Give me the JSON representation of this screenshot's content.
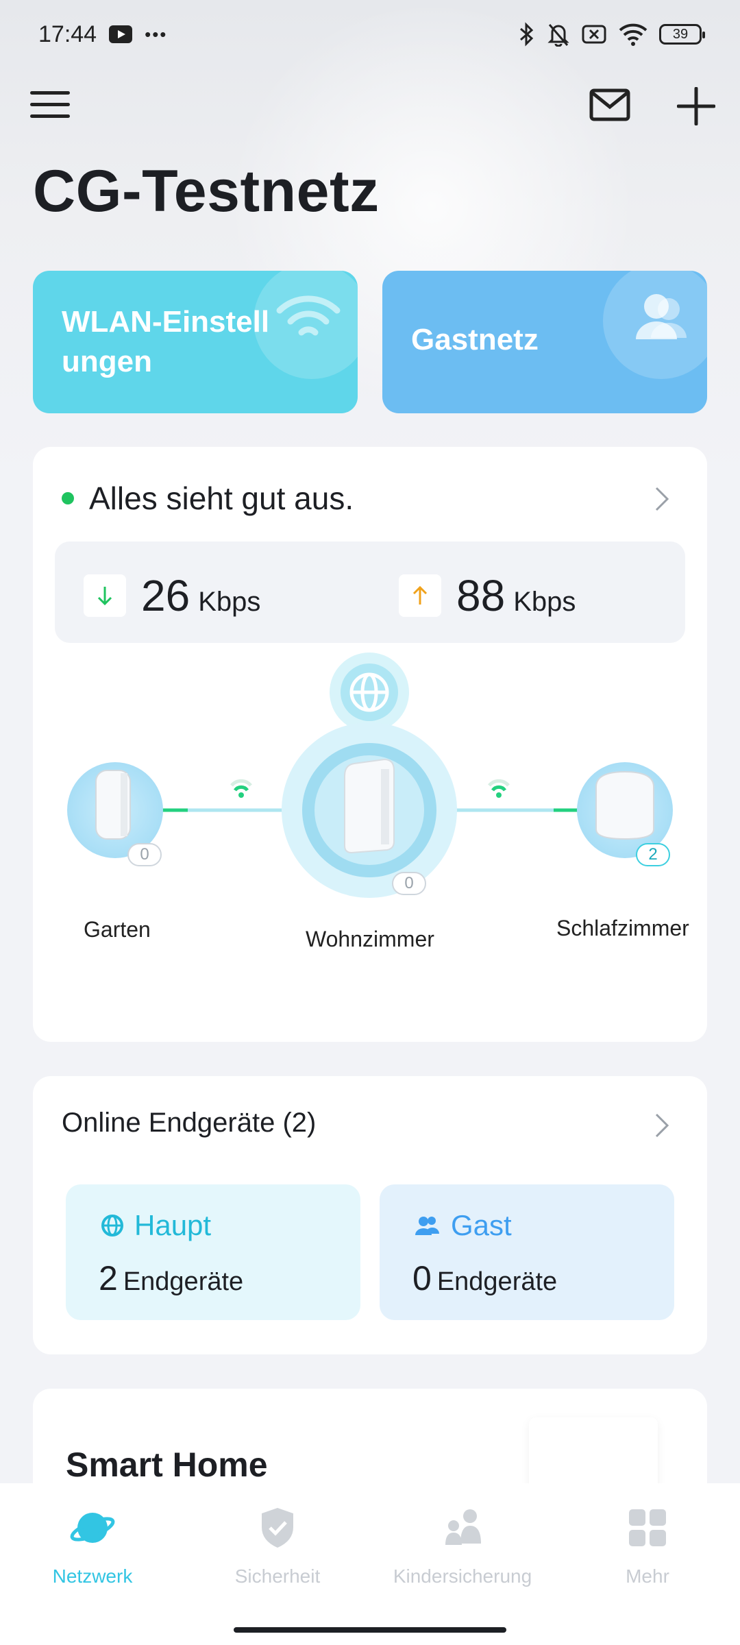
{
  "status_bar": {
    "time": "17:44",
    "more": "•••",
    "battery": "39",
    "icons": [
      "youtube-icon",
      "bluetooth-icon",
      "bell-muted-icon",
      "nosim-icon",
      "wifi-icon",
      "battery-icon"
    ]
  },
  "header": {
    "title": "CG-Testnetz",
    "icons": [
      "menu-icon",
      "mail-icon",
      "plus-icon"
    ]
  },
  "quick_actions": [
    {
      "label": "WLAN-Einstell ungen",
      "icon": "wifi-icon",
      "color": "#5fd6ea"
    },
    {
      "label": "Gastnetz",
      "icon": "guest-user-icon",
      "color": "#6cbdf2"
    }
  ],
  "network_status": {
    "message": "Alles sieht gut aus.",
    "status_color": "#1fc35f",
    "download": {
      "value": "26",
      "unit": "Kbps"
    },
    "upload": {
      "value": "88",
      "unit": "Kbps"
    }
  },
  "topology": {
    "nodes": [
      {
        "name": "Garten",
        "clients": "0"
      },
      {
        "name": "Wohnzimmer",
        "clients": "0"
      },
      {
        "name": "Schlafzimmer",
        "clients": "2"
      }
    ]
  },
  "online_devices": {
    "title": "Online Endgeräte (2)",
    "main": {
      "label": "Haupt",
      "count": "2",
      "unit": "Endgeräte"
    },
    "guest": {
      "label": "Gast",
      "count": "0",
      "unit": "Endgeräte"
    }
  },
  "smart_home": {
    "title": "Smart Home"
  },
  "bottom_nav": [
    {
      "label": "Netzwerk",
      "icon": "planet-icon",
      "active": true
    },
    {
      "label": "Sicherheit",
      "icon": "shield-icon",
      "active": false
    },
    {
      "label": "Kindersicherung",
      "icon": "family-icon",
      "active": false
    },
    {
      "label": "Mehr",
      "icon": "grid-icon",
      "active": false
    }
  ],
  "colors": {
    "accent": "#32c5e3",
    "online": "#1fc35f",
    "upload": "#f0a21b"
  }
}
